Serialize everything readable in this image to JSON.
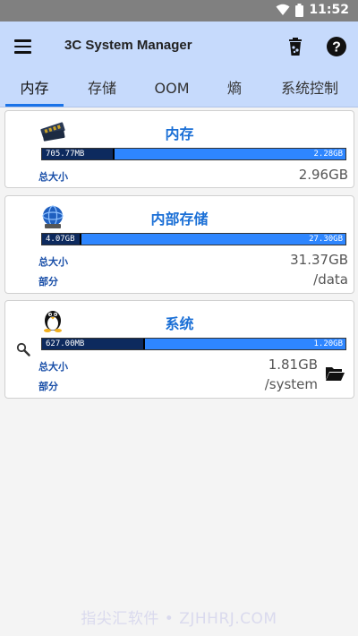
{
  "status_bar": {
    "time": "11:52"
  },
  "app": {
    "title": "3C System Manager"
  },
  "tabs": [
    {
      "label": "内存"
    },
    {
      "label": "存储"
    },
    {
      "label": "OOM"
    },
    {
      "label": "熵"
    },
    {
      "label": "系统控制"
    }
  ],
  "cards": {
    "memory": {
      "title": "内存",
      "used": "705.77MB",
      "free": "2.28GB",
      "used_fraction": 0.24,
      "total_label": "总大小",
      "total_value": "2.96GB"
    },
    "internal_storage": {
      "title": "内部存储",
      "used": "4.07GB",
      "free": "27.30GB",
      "used_fraction": 0.13,
      "total_label": "总大小",
      "total_value": "31.37GB",
      "partition_label": "部分",
      "partition_value": "/data"
    },
    "system": {
      "title": "系统",
      "used": "627.00MB",
      "free": "1.20GB",
      "used_fraction": 0.34,
      "total_label": "总大小",
      "total_value": "1.81GB",
      "partition_label": "部分",
      "partition_value": "/system"
    }
  },
  "watermark": "指尖汇软件 • ZJHHRJ.COM",
  "colors": {
    "app_bar": "#c6dafc",
    "accent": "#1a73e8",
    "bar_free": "#2e86ff",
    "bar_used": "#0d2a5e",
    "title": "#1a6fd6"
  }
}
